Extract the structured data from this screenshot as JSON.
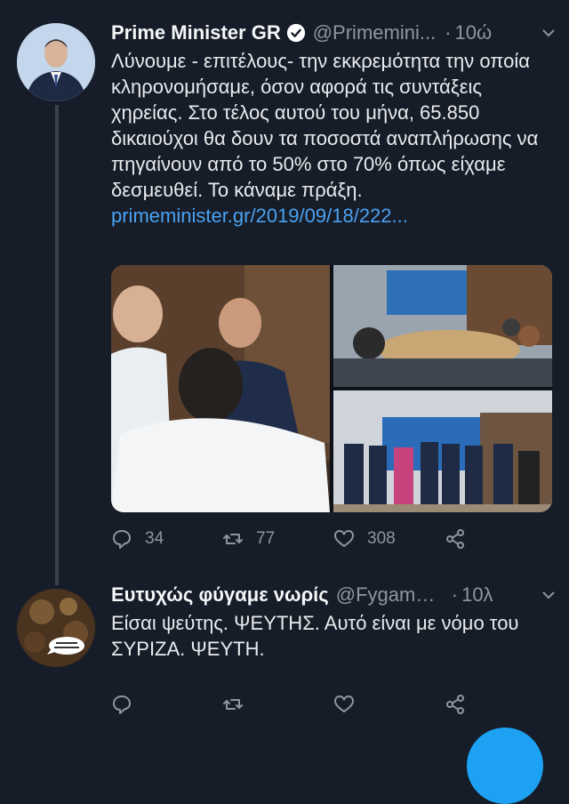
{
  "tweets": [
    {
      "name": "Prime Minister GR",
      "handle": "@Primemini...",
      "dot": "·",
      "time": "10ώ",
      "text": "Λύνουμε - επιτέλους- την εκκρεμότητα την οποία κληρονομήσαμε, όσον αφορά τις συντάξεις χηρείας. Στο τέλος αυτού του μήνα, 65.850 δικαιούχοι θα δουν τα ποσοστά αναπλήρωσης να πηγαίνουν από το 50% στο 70% όπως είχαμε δεσμευθεί. Το κάναμε πράξη. ",
      "link": "primeminister.gr/2019/09/18/222...",
      "replies": "34",
      "retweets": "77",
      "likes": "308"
    },
    {
      "name": "Ευτυχώς φύγαμε νωρίς",
      "handle": "@Fygame...",
      "dot": "·",
      "time": "10λ",
      "text": "Είσαι ψεύτης. ΨΕΥΤΗΣ. Αυτό είναι με νόμο του ΣΥΡΙΖΑ. ΨΕΥΤΗ."
    }
  ],
  "icons": {
    "verified": "verified-badge-icon",
    "caret": "chevron-down-icon",
    "reply": "reply-icon",
    "retweet": "retweet-icon",
    "like": "heart-icon",
    "share": "share-icon"
  },
  "colors": {
    "background": "#161d28",
    "link": "#4ba1f2",
    "muted": "#8c96a1",
    "fab": "#1da1f2"
  }
}
